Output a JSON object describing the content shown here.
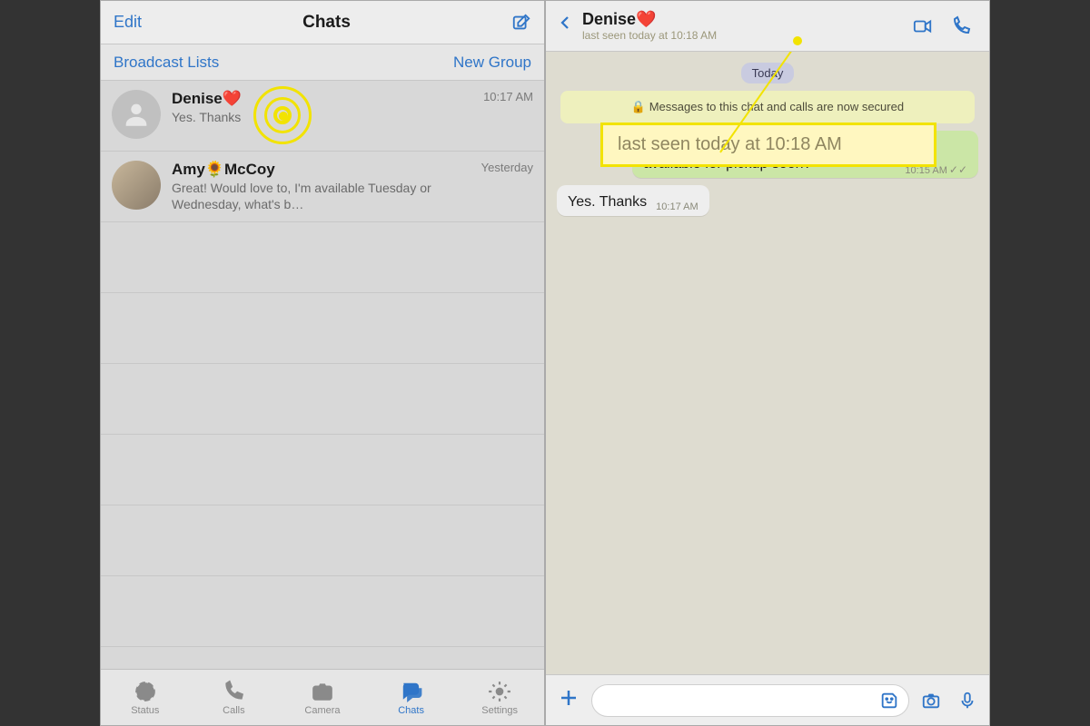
{
  "left": {
    "header": {
      "edit": "Edit",
      "title": "Chats",
      "composeIcon": "compose-icon"
    },
    "subbar": {
      "broadcast": "Broadcast Lists",
      "newgroup": "New Group"
    },
    "rows": [
      {
        "name": "Denise❤️",
        "preview": "Yes. Thanks",
        "time": "10:17 AM",
        "avatar": "silhouette"
      },
      {
        "name": "Amy🌻McCoy",
        "preview": "Great!  Would love to, I'm available Tuesday or Wednesday, what's b…",
        "time": "Yesterday",
        "avatar": "photo"
      }
    ],
    "tabs": [
      {
        "key": "status",
        "label": "Status"
      },
      {
        "key": "calls",
        "label": "Calls"
      },
      {
        "key": "camera",
        "label": "Camera"
      },
      {
        "key": "chats",
        "label": "Chats",
        "active": true
      },
      {
        "key": "settings",
        "label": "Settings"
      }
    ]
  },
  "right": {
    "header": {
      "name": "Denise❤️",
      "lastseen": "last seen today at 10:18 AM"
    },
    "dayLabel": "Today",
    "encryption": "🔒 Messages to this chat and calls are now secured",
    "messages": [
      {
        "dir": "out",
        "text": "Hi Denise! Just wondering if the items will be available for pickup soon?",
        "time": "10:15 AM",
        "ticks": true
      },
      {
        "dir": "in",
        "text": "Yes. Thanks",
        "time": "10:17 AM"
      }
    ],
    "callout": "last seen today at 10:18 AM"
  }
}
